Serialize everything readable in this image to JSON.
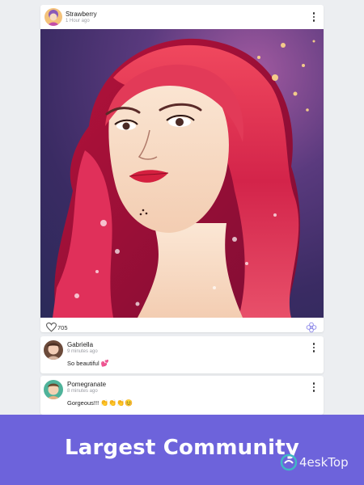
{
  "post": {
    "author": "Strawberry",
    "time": "1 Hour ago",
    "likes": "705",
    "image_icon": "red-haired-woman-portrait-illustration"
  },
  "comments": [
    {
      "author": "Gabriella",
      "time": "9 minutes ago",
      "text": "So beautiful",
      "emoji": "💕"
    },
    {
      "author": "Pomegranate",
      "time": "8 minutes ago",
      "text": "Gorgeous!!!",
      "emoji": "👏👏👏😊"
    }
  ],
  "banner": {
    "title": "Largest Community",
    "watermark": "4eskTop"
  },
  "colors": {
    "banner": "#6d63db",
    "background": "#eceef1",
    "heart_outline": "#555555",
    "flower_icon": "#8b86e8"
  },
  "icons": {
    "more": "more-vertical-icon",
    "like": "heart-outline-icon",
    "flower": "flower-icon"
  }
}
